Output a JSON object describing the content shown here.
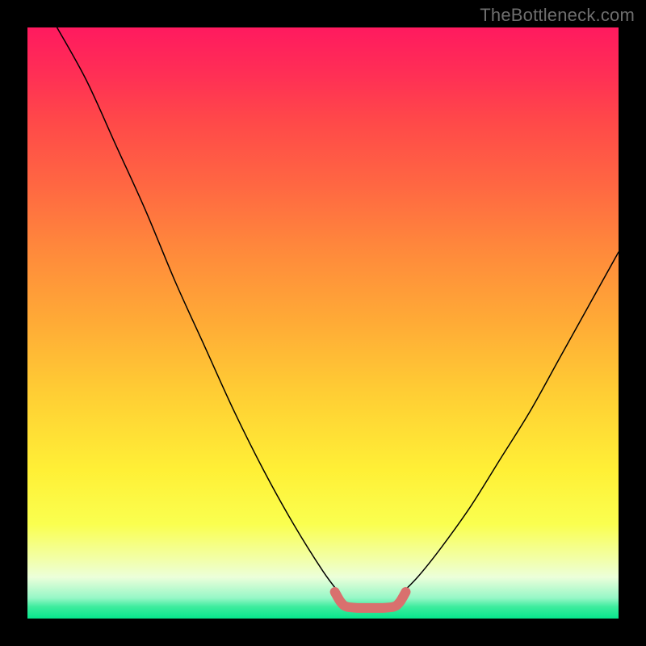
{
  "watermark": "TheBottleneck.com",
  "chart_data": {
    "type": "line",
    "title": "",
    "xlabel": "",
    "ylabel": "",
    "xlim": [
      0,
      100
    ],
    "ylim": [
      0,
      100
    ],
    "grid": false,
    "legend": false,
    "series": [
      {
        "name": "left-curve",
        "color": "#000000",
        "width": 1.5,
        "x": [
          5,
          10,
          15,
          20,
          25,
          30,
          35,
          40,
          45,
          50,
          53
        ],
        "y": [
          100,
          91,
          80,
          69,
          57,
          46,
          35,
          25,
          16,
          8,
          4
        ]
      },
      {
        "name": "right-curve",
        "color": "#000000",
        "width": 1.5,
        "x": [
          63,
          66,
          70,
          75,
          80,
          85,
          90,
          95,
          100
        ],
        "y": [
          4,
          7,
          12,
          19,
          27,
          35,
          44,
          53,
          62
        ]
      },
      {
        "name": "bottom-marker",
        "color": "#d9706e",
        "width": 12,
        "x": [
          52,
          53,
          54,
          56,
          58,
          60,
          62,
          63,
          64
        ],
        "y": [
          4.5,
          2.8,
          2.0,
          1.8,
          1.8,
          1.8,
          2.0,
          2.8,
          4.5
        ]
      }
    ]
  }
}
